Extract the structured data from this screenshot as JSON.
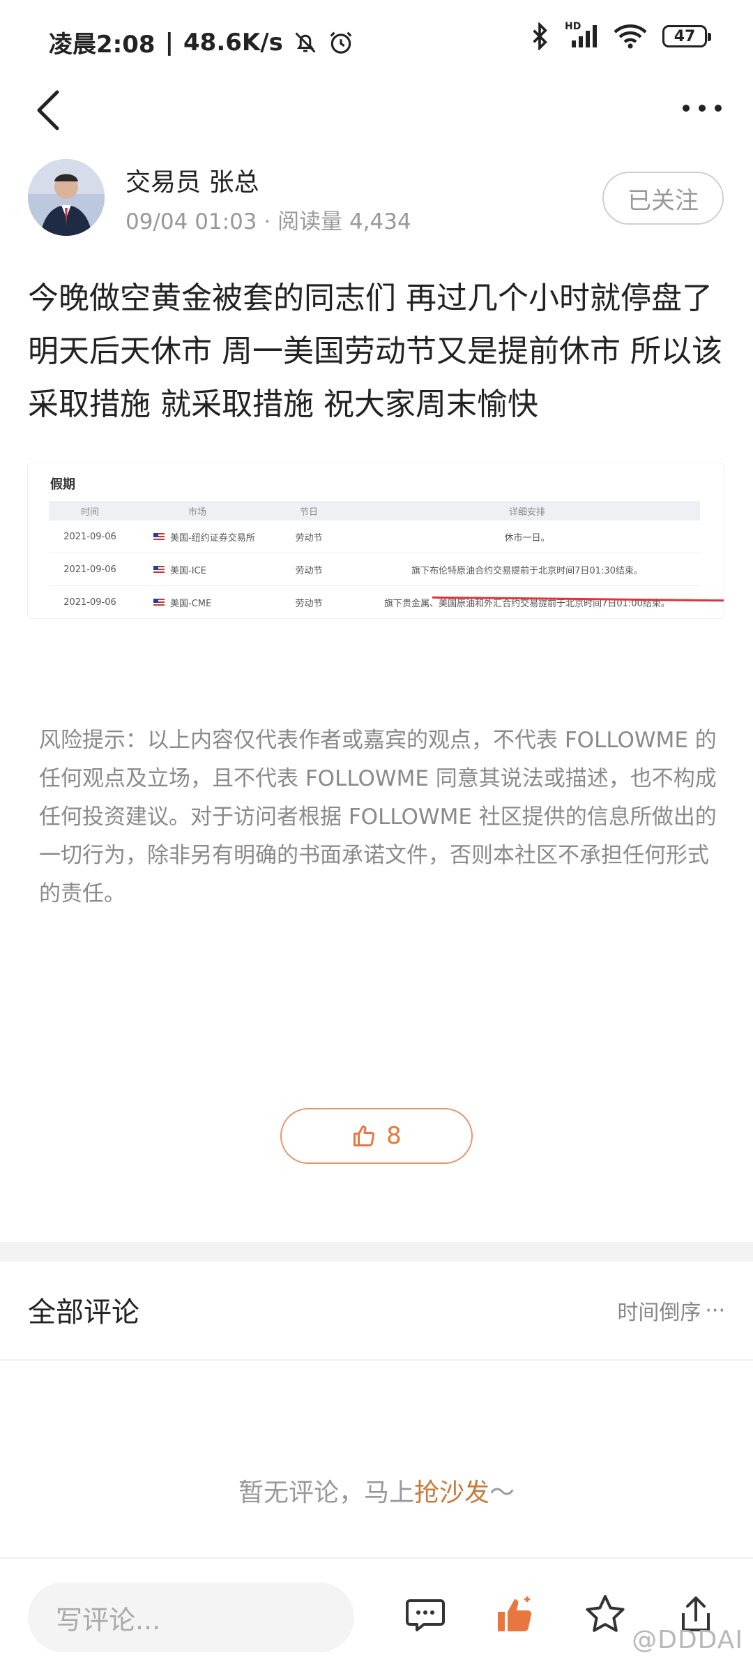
{
  "status": {
    "time": "凌晨2:08",
    "separator": "|",
    "speed": "48.6K/s",
    "network": "HD",
    "battery": "47"
  },
  "author": {
    "name": "交易员 张总",
    "meta": "09/04 01:03 · 阅读量 4,434",
    "follow_label": "已关注"
  },
  "post": {
    "text": "今晚做空黄金被套的同志们 再过几个小时就停盘了 明天后天休市 周一美国劳动节又是提前休市 所以该采取措施 就采取措施 祝大家周末愉快"
  },
  "image": {
    "title": "假期",
    "headers": [
      "时间",
      "市场",
      "节日",
      "详细安排"
    ],
    "rows": [
      [
        "2021-09-06",
        "美国-纽约证券交易所",
        "劳动节",
        "休市一日。"
      ],
      [
        "2021-09-06",
        "美国-ICE",
        "劳动节",
        "旗下布伦特原油合约交易提前于北京时间7日01:30结束。"
      ],
      [
        "2021-09-06",
        "美国-CME",
        "劳动节",
        "旗下贵金属、美国原油和外汇合约交易提前于北京时间7日01:00结束。"
      ]
    ]
  },
  "risk": {
    "text": "风险提示：以上内容仅代表作者或嘉宾的观点，不代表 FOLLOWME 的任何观点及立场，且不代表 FOLLOWME 同意其说法或描述，也不构成任何投资建议。对于访问者根据 FOLLOWME 社区提供的信息所做出的一切行为，除非另有明确的书面承诺文件，否则本社区不承担任何形式的责任。"
  },
  "like": {
    "count": "8"
  },
  "comments": {
    "title": "全部评论",
    "sort_label": "时间倒序",
    "sort_more": "···",
    "empty_prefix": "暂无评论，马上",
    "empty_link": "抢沙发",
    "empty_suffix": "～"
  },
  "bottom": {
    "input_placeholder": "写评论...",
    "watermark": "@DDDAI"
  },
  "colors": {
    "accent": "#e9763f",
    "link": "#c87a3b",
    "text_gray": "#8a8a8a"
  },
  "icons": [
    "back-arrow-icon",
    "more-icon",
    "like-icon",
    "comment-icon",
    "star-icon",
    "share-icon",
    "bluetooth-icon",
    "wifi-icon",
    "signal-icon",
    "bell-off-icon",
    "alarm-icon"
  ]
}
